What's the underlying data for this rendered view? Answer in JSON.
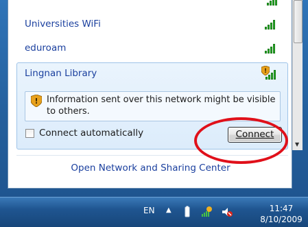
{
  "networks": [
    {
      "name": "Universities WiFi"
    },
    {
      "name": "eduroam"
    }
  ],
  "selected_network": {
    "name": "Lingnan Library",
    "warning": "Information sent over this network might be visible to others.",
    "connect_automatically_label": "Connect automatically",
    "connect_automatically_checked": false,
    "connect_button_label": "Connect"
  },
  "footer": {
    "link": "Open Network and Sharing Center"
  },
  "taskbar": {
    "language": "EN",
    "time": "11:47",
    "date": "8/10/2009"
  },
  "colors": {
    "link": "#1a3f9e",
    "signal": "#2bb02b",
    "highlight_ellipse": "#e0101a",
    "taskbar": "#1f5590"
  },
  "icons": [
    "signal-strength-icon",
    "security-shield-icon",
    "show-hidden-icons-arrow",
    "battery-icon",
    "network-warning-icon",
    "volume-muted-icon"
  ]
}
